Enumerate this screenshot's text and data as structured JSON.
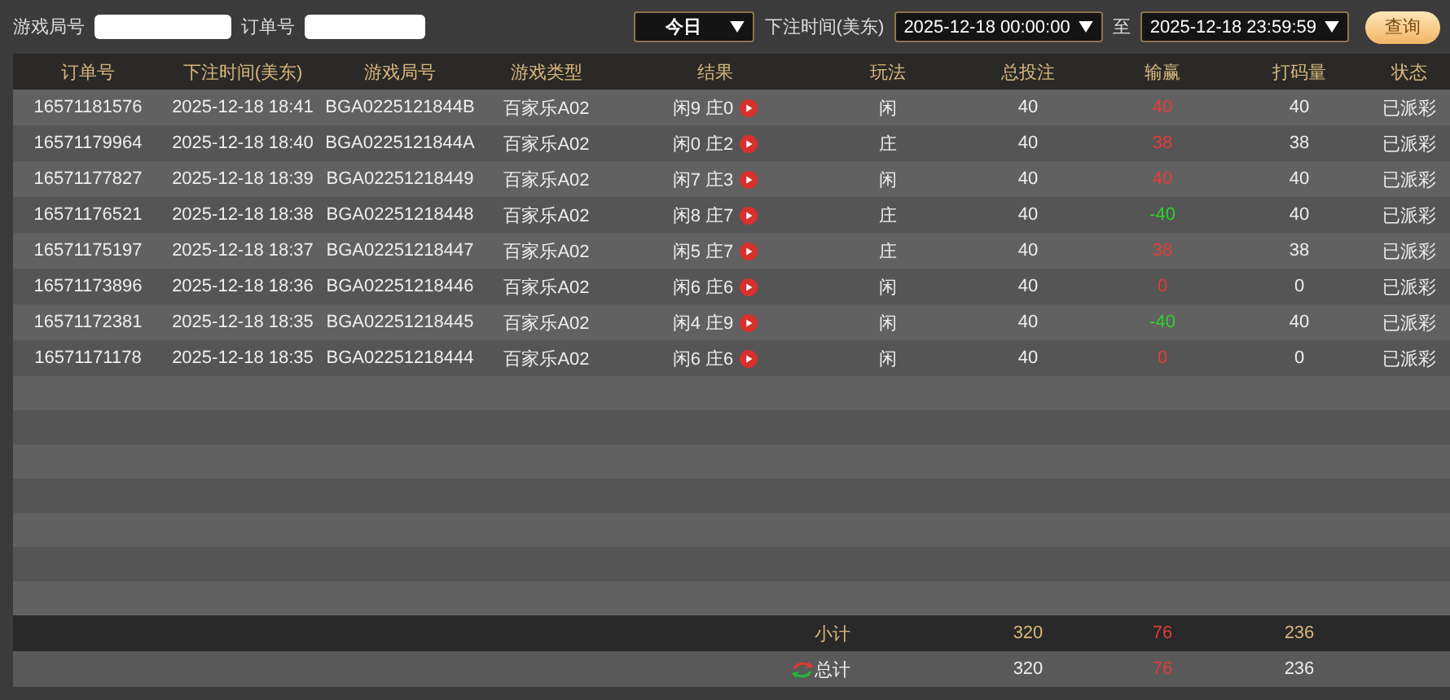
{
  "filters": {
    "round_label": "游戏局号",
    "order_label": "订单号",
    "period": "今日",
    "time_label": "下注时间(美东)",
    "start": "2025-12-18 00:00:00",
    "to_label": "至",
    "end": "2025-12-18 23:59:59",
    "query_button": "查询"
  },
  "table": {
    "columns": [
      "订单号",
      "下注时间(美东)",
      "游戏局号",
      "游戏类型",
      "结果",
      "玩法",
      "总投注",
      "输赢",
      "打码量",
      "状态"
    ],
    "rows": [
      {
        "order": "16571181576",
        "time": "2025-12-18 18:41",
        "round": "BGA0225121844B",
        "game": "百家乐A02",
        "result": "闲9 庄0",
        "play": "闲",
        "bet": "40",
        "win": "40",
        "color": "#e23c3a",
        "turnover": "40",
        "status": "已派彩"
      },
      {
        "order": "16571179964",
        "time": "2025-12-18 18:40",
        "round": "BGA0225121844A",
        "game": "百家乐A02",
        "result": "闲0 庄2",
        "play": "庄",
        "bet": "40",
        "win": "38",
        "color": "#e23c3a",
        "turnover": "38",
        "status": "已派彩"
      },
      {
        "order": "16571177827",
        "time": "2025-12-18 18:39",
        "round": "BGA02251218449",
        "game": "百家乐A02",
        "result": "闲7 庄3",
        "play": "闲",
        "bet": "40",
        "win": "40",
        "color": "#e23c3a",
        "turnover": "40",
        "status": "已派彩"
      },
      {
        "order": "16571176521",
        "time": "2025-12-18 18:38",
        "round": "BGA02251218448",
        "game": "百家乐A02",
        "result": "闲8 庄7",
        "play": "庄",
        "bet": "40",
        "win": "-40",
        "color": "#2ed12e",
        "turnover": "40",
        "status": "已派彩"
      },
      {
        "order": "16571175197",
        "time": "2025-12-18 18:37",
        "round": "BGA02251218447",
        "game": "百家乐A02",
        "result": "闲5 庄7",
        "play": "庄",
        "bet": "40",
        "win": "38",
        "color": "#e23c3a",
        "turnover": "38",
        "status": "已派彩"
      },
      {
        "order": "16571173896",
        "time": "2025-12-18 18:36",
        "round": "BGA02251218446",
        "game": "百家乐A02",
        "result": "闲6 庄6",
        "play": "闲",
        "bet": "40",
        "win": "0",
        "color": "#e23c3a",
        "turnover": "0",
        "status": "已派彩"
      },
      {
        "order": "16571172381",
        "time": "2025-12-18 18:35",
        "round": "BGA02251218445",
        "game": "百家乐A02",
        "result": "闲4 庄9",
        "play": "闲",
        "bet": "40",
        "win": "-40",
        "color": "#2ed12e",
        "turnover": "40",
        "status": "已派彩"
      },
      {
        "order": "16571171178",
        "time": "2025-12-18 18:35",
        "round": "BGA02251218444",
        "game": "百家乐A02",
        "result": "闲6 庄6",
        "play": "闲",
        "bet": "40",
        "win": "0",
        "color": "#e23c3a",
        "turnover": "0",
        "status": "已派彩"
      }
    ],
    "summary": [
      {
        "kind": "subtotal",
        "label": "小计",
        "bet": "320",
        "win": "76",
        "turnover": "236"
      },
      {
        "kind": "total",
        "label": "总计",
        "bet": "320",
        "win": "76",
        "turnover": "236"
      }
    ]
  }
}
